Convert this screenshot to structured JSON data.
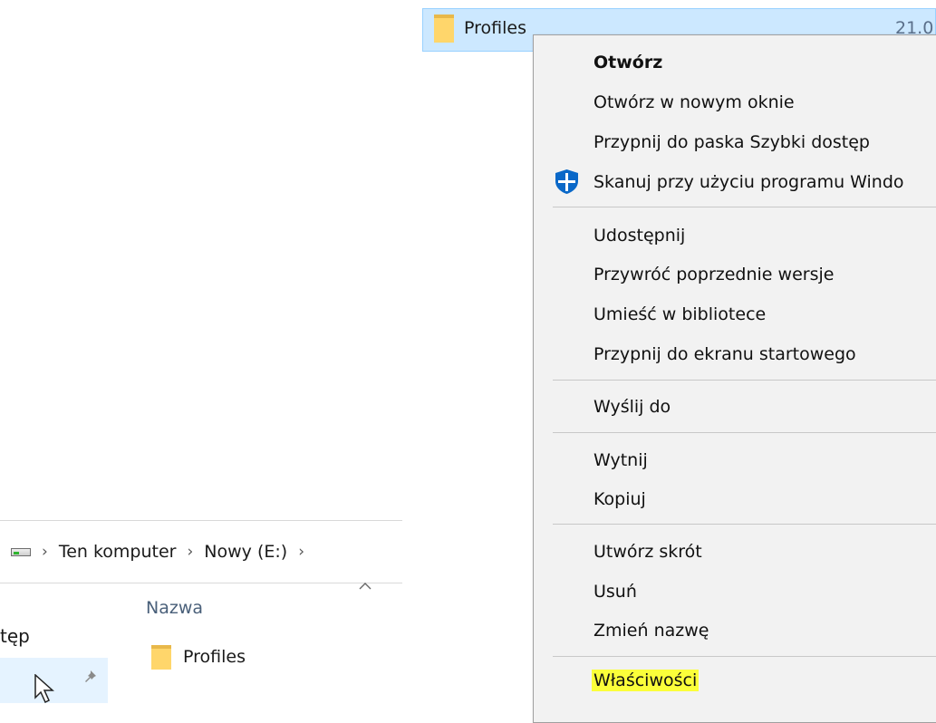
{
  "explorer": {
    "breadcrumb": [
      "Ten komputer",
      "Nowy (E:)"
    ],
    "column_header": "Nazwa",
    "sidebar_label": "tęp",
    "files": [
      {
        "name": "Profiles",
        "icon": "folder-icon"
      }
    ]
  },
  "selected_item": {
    "name": "Profiles",
    "date_partial": "21.0"
  },
  "context_menu": {
    "items": [
      {
        "label": "Otwórz",
        "bold": true
      },
      {
        "label": "Otwórz w nowym oknie"
      },
      {
        "label": "Przypnij do paska Szybki dostęp"
      },
      {
        "label": "Skanuj przy użyciu programu Windo",
        "icon": "windows-defender-icon"
      },
      {
        "label": "Udostępnij"
      },
      {
        "label": "Przywróć poprzednie wersje"
      },
      {
        "label": "Umieść w bibliotece"
      },
      {
        "label": "Przypnij do ekranu startowego"
      },
      {
        "label": "Wyślij do"
      },
      {
        "label": "Wytnij"
      },
      {
        "label": "Kopiuj"
      },
      {
        "label": "Utwórz skrót"
      },
      {
        "label": "Usuń"
      },
      {
        "label": "Zmień nazwę"
      },
      {
        "label": "Właściwości",
        "highlighted": true
      }
    ]
  },
  "colors": {
    "selection": "#cce8ff",
    "selection_border": "#99d1ff",
    "menu_bg": "#f2f2f2",
    "highlight": "#fbff3a",
    "folder": "#ffd66b"
  }
}
